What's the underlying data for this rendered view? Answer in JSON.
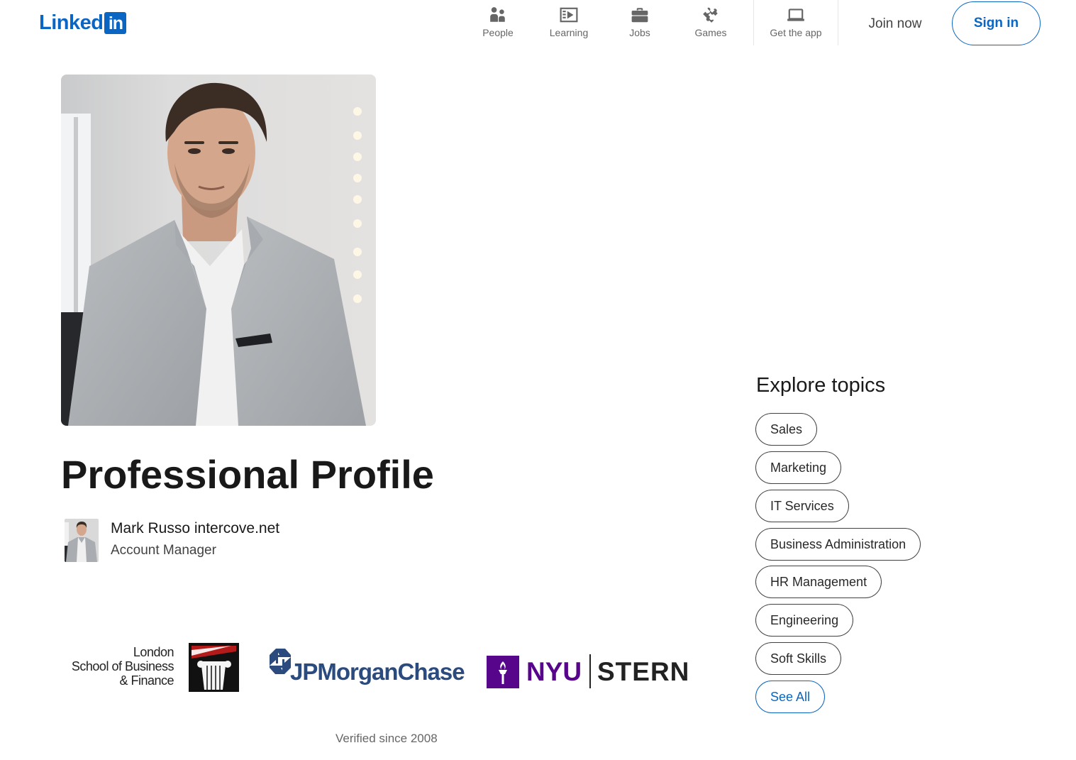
{
  "header": {
    "logo": {
      "text": "Linked",
      "box_text": "in",
      "color": "#0a66c2"
    },
    "nav": [
      {
        "label": "People",
        "icon": "people-icon"
      },
      {
        "label": "Learning",
        "icon": "learning-video-icon"
      },
      {
        "label": "Jobs",
        "icon": "briefcase-icon"
      },
      {
        "label": "Games",
        "icon": "puzzle-piece-icon"
      },
      {
        "label": "Get the app",
        "icon": "laptop-icon"
      }
    ],
    "join_label": "Join now",
    "signin_label": "Sign in"
  },
  "profile": {
    "photo_alt": "portrait-photo",
    "title": "Professional Profile",
    "author_name": "Mark Russo intercove.net",
    "author_role": "Account Manager"
  },
  "logos": {
    "lsbf": {
      "line1": "London",
      "line2": "School of Business",
      "line3": "& Finance"
    },
    "jpm": {
      "text": "JPMorganChase",
      "color": "#2b4b7e"
    },
    "nyu": {
      "left": "NYU",
      "right": "STERN",
      "color": "#57068c"
    }
  },
  "verified": "Verified since 2008",
  "topics": {
    "title": "Explore topics",
    "items": [
      "Sales",
      "Marketing",
      "IT Services",
      "Business Administration",
      "HR Management",
      "Engineering",
      "Soft Skills"
    ],
    "see_all": "See All"
  },
  "colors": {
    "brand": "#0a66c2",
    "muted": "#666666"
  }
}
